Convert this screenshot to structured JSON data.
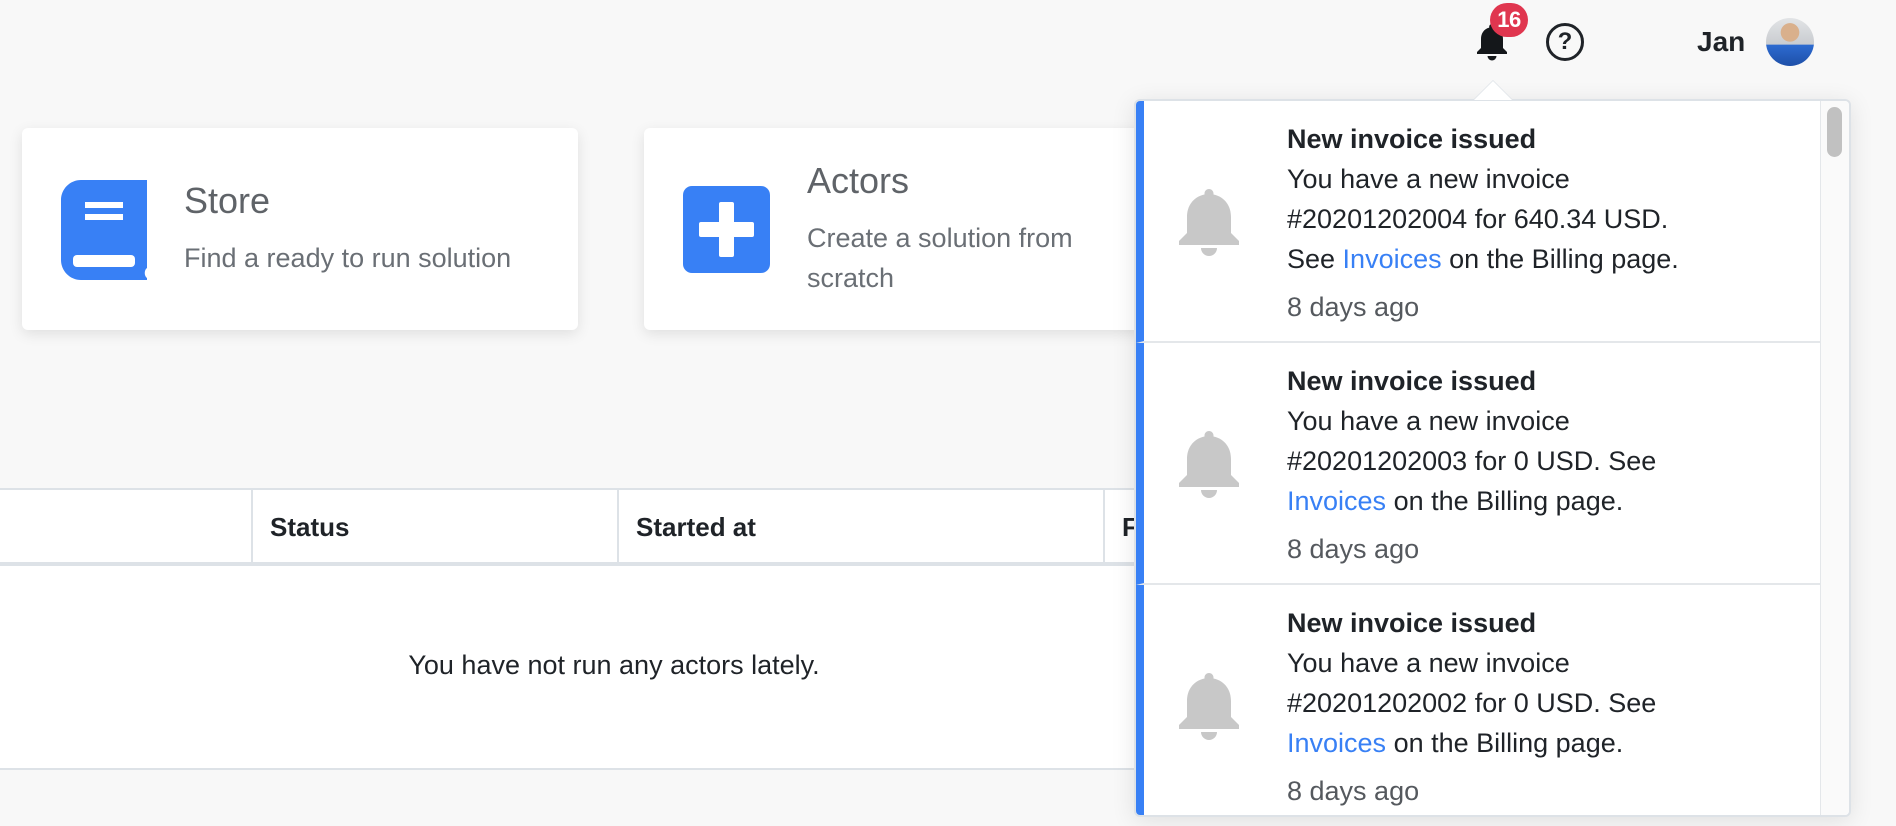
{
  "header": {
    "notification_count": "16",
    "help_glyph": "?",
    "user_name": "Jan",
    "icons": {
      "notifications": "bell-icon",
      "help": "question-circle-icon",
      "avatar": "user-avatar"
    }
  },
  "cards": [
    {
      "icon": "book-icon",
      "title": "Store",
      "description": "Find a ready to run solution"
    },
    {
      "icon": "plus-square-icon",
      "title": "Actors",
      "description_line1": "Create a solution from",
      "description_line2": "scratch"
    }
  ],
  "runs_table": {
    "columns": [
      "",
      "Status",
      "Started at",
      "F"
    ],
    "empty_message": "You have not run any actors lately."
  },
  "notifications": {
    "items": [
      {
        "icon": "bell-icon",
        "title": "New invoice issued",
        "line1": "You have a new invoice",
        "line2": "#20201202004 for 640.34 USD.",
        "line3_prefix": "See ",
        "link": "Invoices",
        "line3_suffix": " on the Billing page.",
        "time": "8 days ago"
      },
      {
        "icon": "bell-icon",
        "title": "New invoice issued",
        "line1": "You have a new invoice",
        "line2": "#20201202003 for 0 USD. See",
        "line3_prefix": "",
        "link": "Invoices",
        "line3_suffix": " on the Billing page.",
        "time": "8 days ago"
      },
      {
        "icon": "bell-icon",
        "title": "New invoice issued",
        "line1": "You have a new invoice",
        "line2": "#20201202002 for 0 USD. See",
        "line3_prefix": "",
        "link": "Invoices",
        "line3_suffix": " on the Billing page.",
        "time": "8 days ago"
      }
    ]
  },
  "colors": {
    "accent": "#3880f5",
    "badge": "#e0364f",
    "background": "#f8f8f8",
    "muted_icon": "#c8c8c8"
  }
}
